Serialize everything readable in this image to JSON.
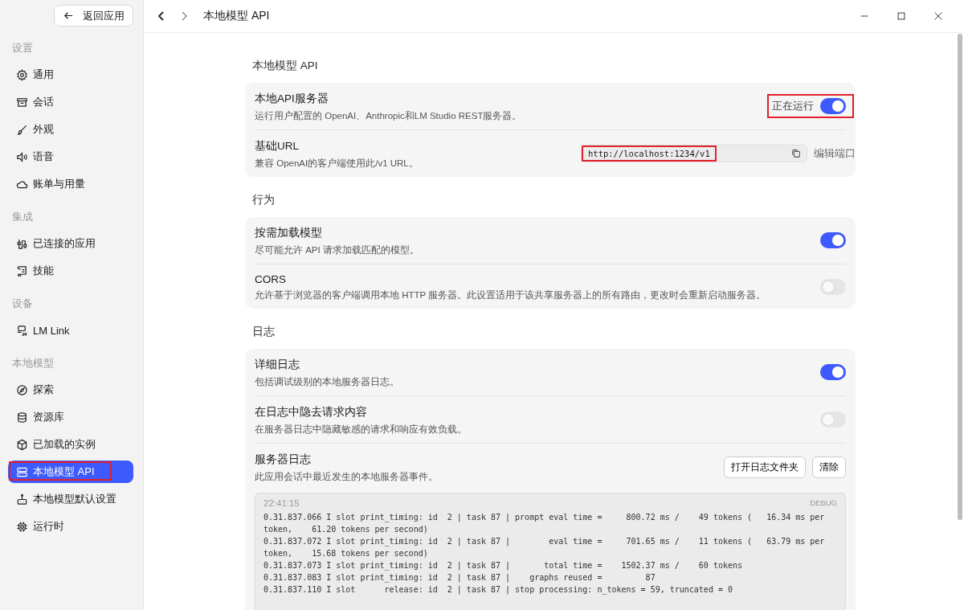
{
  "back_button": "返回应用",
  "sidebar": {
    "sections": [
      {
        "heading": "设置",
        "items": [
          {
            "label": "通用",
            "selected": false,
            "highlighted": false
          },
          {
            "label": "会话",
            "selected": false,
            "highlighted": false
          },
          {
            "label": "外观",
            "selected": false,
            "highlighted": false
          },
          {
            "label": "语音",
            "selected": false,
            "highlighted": false
          },
          {
            "label": "账单与用量",
            "selected": false,
            "highlighted": false
          }
        ]
      },
      {
        "heading": "集成",
        "items": [
          {
            "label": "已连接的应用",
            "selected": false,
            "highlighted": false
          },
          {
            "label": "技能",
            "selected": false,
            "highlighted": false
          }
        ]
      },
      {
        "heading": "设备",
        "items": [
          {
            "label": "LM Link",
            "selected": false,
            "highlighted": false
          }
        ]
      },
      {
        "heading": "本地模型",
        "items": [
          {
            "label": "探索",
            "selected": false,
            "highlighted": false
          },
          {
            "label": "资源库",
            "selected": false,
            "highlighted": false
          },
          {
            "label": "已加载的实例",
            "selected": false,
            "highlighted": false
          },
          {
            "label": "本地模型 API",
            "selected": true,
            "highlighted": true
          },
          {
            "label": "本地模型默认设置",
            "selected": false,
            "highlighted": false
          },
          {
            "label": "运行时",
            "selected": false,
            "highlighted": false
          }
        ]
      }
    ]
  },
  "header": {
    "title": "本地模型 API"
  },
  "groups": [
    {
      "heading": "本地模型 API",
      "rows": [
        {
          "kind": "toggle",
          "title": "本地API服务器",
          "description": "运行用户配置的 OpenAI、Anthropic和LM Studio REST服务器。",
          "status": "正在运行",
          "on": true,
          "highlighted": true
        },
        {
          "kind": "url",
          "title": "基础URL",
          "description": "兼容 OpenAI的客户端使用此/v1 URL。",
          "value": "http://localhost:1234/v1",
          "highlighted": true,
          "action": "编辑端口"
        }
      ]
    },
    {
      "heading": "行为",
      "rows": [
        {
          "kind": "toggle",
          "title": "按需加载模型",
          "description": "尽可能允许 API 请求加载匹配的模型。",
          "on": true,
          "highlighted": false
        },
        {
          "kind": "toggle",
          "title": "CORS",
          "description": "允许基于浏览器的客户端调用本地 HTTP 服务器。此设置适用于该共享服务器上的所有路由，更改时会重新启动服务器。",
          "on": false,
          "highlighted": false
        }
      ]
    },
    {
      "heading": "日志",
      "rows": [
        {
          "kind": "toggle",
          "title": "详细日志",
          "description": "包括调试级别的本地服务器日志。",
          "on": true,
          "highlighted": false
        },
        {
          "kind": "toggle",
          "title": "在日志中隐去请求内容",
          "description": "在服务器日志中隐藏敏感的请求和响应有效负载。",
          "on": false,
          "highlighted": false
        },
        {
          "kind": "log",
          "title": "服务器日志",
          "description": "此应用会话中最近发生的本地服务器事件。",
          "buttons": [
            "打开日志文件夹",
            "清除"
          ],
          "log": {
            "time": "22:41:15",
            "level": "DEBUG",
            "lines": [
              "0.31.837.066 I slot print_timing: id  2 | task 87 | prompt eval time =     800.72 ms /    49 tokens (   16.34 ms per",
              "token,    61.20 tokens per second)",
              "0.31.837.072 I slot print_timing: id  2 | task 87 |        eval time =     701.65 ms /    11 tokens (   63.79 ms per",
              "token,    15.68 tokens per second)",
              "0.31.837.073 I slot print_timing: id  2 | task 87 |       total time =    1502.37 ms /    60 tokens",
              "0.31.837.083 I slot print_timing: id  2 | task 87 |    graphs reused =         87",
              "0.31.837.110 I slot      release: id  2 | task 87 | stop processing: n_tokens = 59, truncated = 0"
            ]
          }
        }
      ]
    }
  ]
}
